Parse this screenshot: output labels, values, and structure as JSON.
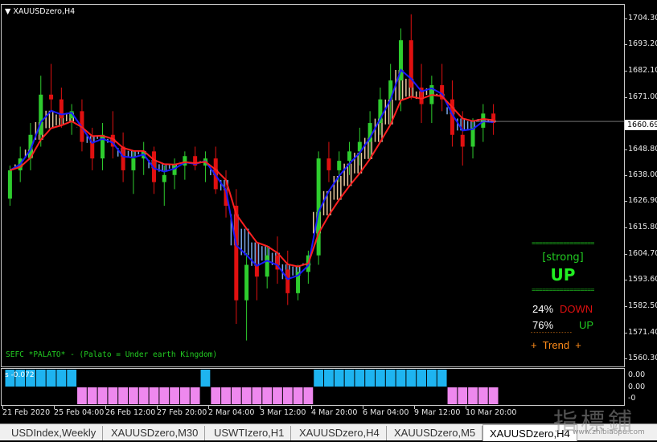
{
  "chart_title": "XAUUSDzero,H4",
  "price_axis": [
    "1704.30",
    "1693.20",
    "1682.10",
    "1671.00",
    "1648.80",
    "1638.00",
    "1626.90",
    "1615.80",
    "1604.70",
    "1593.60",
    "1582.50",
    "1571.40",
    "1560.30"
  ],
  "current_price": "1660.69",
  "signal_panel": {
    "separator": "==================",
    "strength": "[strong]",
    "direction": "UP",
    "down_pct": "24%",
    "down_label": "DOWN",
    "up_pct": "76%",
    "up_label": "UP",
    "trend_dashes": "- - - - - - - - - - - - - - -",
    "trend_label": "+  Trend  +"
  },
  "indicator_note": "SEFC *PALATO* - (Palato = Under earth Kingdom)",
  "sub_panel": {
    "label": "s -0.072",
    "axis": [
      "0.00",
      "0.00",
      "-0"
    ]
  },
  "time_axis": [
    "21 Feb 2020",
    "25 Feb 04:00",
    "26 Feb 12:00",
    "27 Feb 20:00",
    "2 Mar 04:00",
    "3 Mar 12:00",
    "4 Mar 20:00",
    "6 Mar 04:00",
    "9 Mar 12:00",
    "10 Mar 20:00"
  ],
  "tabs": [
    "USDIndex,Weekly",
    "XAUUSDzero,M30",
    "USWTIzero,H1",
    "XAUUSDzero,H4",
    "XAUUSDzero,M5",
    "XAUUSDzero,H4"
  ],
  "active_tab": 5,
  "watermark": "指標鋪",
  "watermark_url": "www.zhibiaopu.com",
  "colors": {
    "bull": "#2ecc2e",
    "bear": "#e01010",
    "ma_fast": "#1a1aff",
    "ma_slow": "#ff2020",
    "ribbon_up": "#e8c8a0",
    "ribbon_down": "#7aa8e8",
    "hist_blue": "#1eb4f0",
    "hist_pink": "#ee88ee",
    "note": "#22cc22"
  },
  "chart_data": {
    "type": "candlestick",
    "ylim": [
      1557,
      1710
    ],
    "candles": [
      [
        1628,
        1642,
        1625,
        1640
      ],
      [
        1640,
        1650,
        1635,
        1645
      ],
      [
        1645,
        1660,
        1640,
        1655
      ],
      [
        1655,
        1680,
        1650,
        1672
      ],
      [
        1672,
        1685,
        1665,
        1670
      ],
      [
        1670,
        1675,
        1658,
        1662
      ],
      [
        1662,
        1668,
        1655,
        1665
      ],
      [
        1665,
        1670,
        1648,
        1652
      ],
      [
        1652,
        1658,
        1640,
        1645
      ],
      [
        1645,
        1660,
        1640,
        1655
      ],
      [
        1655,
        1665,
        1645,
        1650
      ],
      [
        1650,
        1656,
        1635,
        1640
      ],
      [
        1640,
        1648,
        1630,
        1645
      ],
      [
        1645,
        1652,
        1638,
        1648
      ],
      [
        1648,
        1650,
        1630,
        1635
      ],
      [
        1635,
        1642,
        1625,
        1638
      ],
      [
        1638,
        1645,
        1632,
        1642
      ],
      [
        1642,
        1648,
        1636,
        1646
      ],
      [
        1646,
        1650,
        1640,
        1642
      ],
      [
        1642,
        1648,
        1635,
        1645
      ],
      [
        1645,
        1650,
        1630,
        1632
      ],
      [
        1632,
        1640,
        1620,
        1625
      ],
      [
        1625,
        1632,
        1575,
        1585
      ],
      [
        1585,
        1605,
        1568,
        1600
      ],
      [
        1600,
        1610,
        1585,
        1595
      ],
      [
        1595,
        1608,
        1590,
        1604
      ],
      [
        1604,
        1612,
        1592,
        1598
      ],
      [
        1598,
        1606,
        1583,
        1588
      ],
      [
        1588,
        1600,
        1585,
        1597
      ],
      [
        1597,
        1606,
        1592,
        1604
      ],
      [
        1604,
        1648,
        1600,
        1645
      ],
      [
        1645,
        1652,
        1635,
        1640
      ],
      [
        1640,
        1648,
        1635,
        1644
      ],
      [
        1644,
        1652,
        1638,
        1648
      ],
      [
        1648,
        1658,
        1642,
        1652
      ],
      [
        1652,
        1665,
        1645,
        1660
      ],
      [
        1660,
        1675,
        1655,
        1670
      ],
      [
        1670,
        1685,
        1660,
        1678
      ],
      [
        1678,
        1700,
        1665,
        1695
      ],
      [
        1695,
        1706,
        1670,
        1675
      ],
      [
        1675,
        1685,
        1660,
        1668
      ],
      [
        1668,
        1680,
        1660,
        1676
      ],
      [
        1676,
        1685,
        1665,
        1670
      ],
      [
        1670,
        1678,
        1650,
        1655
      ],
      [
        1655,
        1665,
        1642,
        1650
      ],
      [
        1650,
        1662,
        1645,
        1658
      ],
      [
        1658,
        1668,
        1652,
        1664
      ],
      [
        1664,
        1668,
        1655,
        1660
      ]
    ]
  }
}
